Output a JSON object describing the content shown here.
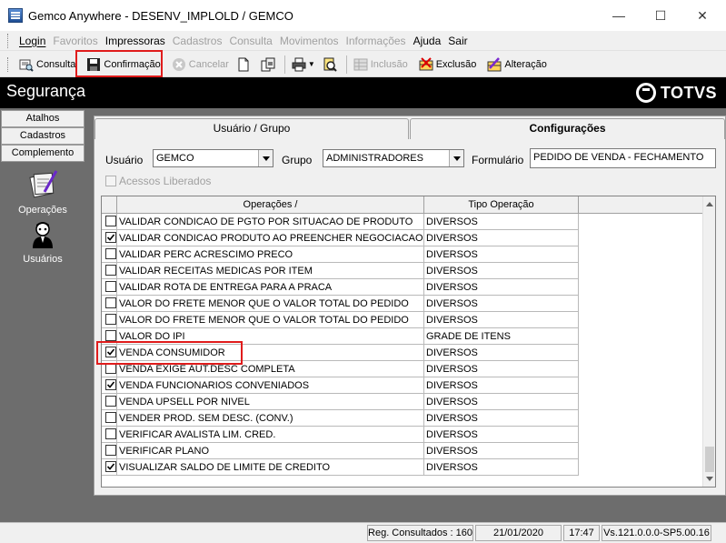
{
  "window": {
    "title": "Gemco Anywhere - DESENV_IMPLOLD / GEMCO",
    "minimize": "—",
    "maximize": "☐",
    "close": "✕"
  },
  "menu": [
    {
      "label": "Login",
      "enabled": true
    },
    {
      "label": "Favoritos",
      "enabled": false
    },
    {
      "label": "Impressoras",
      "enabled": true
    },
    {
      "label": "Cadastros",
      "enabled": false
    },
    {
      "label": "Consulta",
      "enabled": false
    },
    {
      "label": "Movimentos",
      "enabled": false
    },
    {
      "label": "Informações",
      "enabled": false
    },
    {
      "label": "Ajuda",
      "enabled": true
    },
    {
      "label": "Sair",
      "enabled": true
    }
  ],
  "toolbar": {
    "consulta": "Consulta",
    "confirmacao": "Confirmação",
    "cancelar": "Cancelar",
    "inclusao": "Inclusão",
    "exclusao": "Exclusão",
    "alteracao": "Alteração"
  },
  "header": {
    "title": "Segurança",
    "brand": "TOTVS"
  },
  "sidebar": {
    "atalhos": "Atalhos",
    "cadastros": "Cadastros",
    "complemento": "Complemento",
    "operacoes": "Operações",
    "usuarios": "Usuários"
  },
  "tabs": {
    "usuario_grupo": "Usuário  / Grupo",
    "configuracoes": "Configurações"
  },
  "filters": {
    "usuario_label": "Usuário",
    "usuario_value": "GEMCO",
    "grupo_label": "Grupo",
    "grupo_value": "ADMINISTRADORES",
    "formulario_label": "Formulário",
    "formulario_value": "PEDIDO DE VENDA - FECHAMENTO",
    "acessos_liberados": "Acessos Liberados"
  },
  "table": {
    "headers": {
      "operacoes": "Operações  /",
      "tipo": "Tipo Operação"
    },
    "rows": [
      {
        "checked": false,
        "operacao": "VALIDAR CONDICAO DE PGTO POR SITUACAO DE PRODUTO",
        "tipo": "DIVERSOS"
      },
      {
        "checked": true,
        "operacao": "VALIDAR CONDICAO PRODUTO AO PREENCHER NEGOCIACAO",
        "tipo": "DIVERSOS"
      },
      {
        "checked": false,
        "operacao": "VALIDAR PERC ACRESCIMO PRECO",
        "tipo": "DIVERSOS"
      },
      {
        "checked": false,
        "operacao": "VALIDAR RECEITAS MEDICAS POR ITEM",
        "tipo": "DIVERSOS"
      },
      {
        "checked": false,
        "operacao": "VALIDAR ROTA DE ENTREGA PARA A PRACA",
        "tipo": "DIVERSOS"
      },
      {
        "checked": false,
        "operacao": "VALOR DO FRETE MENOR QUE O VALOR TOTAL DO PEDIDO",
        "tipo": "DIVERSOS"
      },
      {
        "checked": false,
        "operacao": "VALOR DO FRETE MENOR QUE O VALOR TOTAL DO PEDIDO",
        "tipo": "DIVERSOS"
      },
      {
        "checked": false,
        "operacao": "VALOR DO IPI",
        "tipo": "GRADE DE ITENS"
      },
      {
        "checked": true,
        "operacao": "VENDA CONSUMIDOR",
        "tipo": "DIVERSOS"
      },
      {
        "checked": false,
        "operacao": "VENDA EXIGE AUT.DESC COMPLETA",
        "tipo": "DIVERSOS"
      },
      {
        "checked": true,
        "operacao": "VENDA FUNCIONARIOS CONVENIADOS",
        "tipo": "DIVERSOS"
      },
      {
        "checked": false,
        "operacao": "VENDA UPSELL POR NIVEL",
        "tipo": "DIVERSOS"
      },
      {
        "checked": false,
        "operacao": "VENDER PROD. SEM DESC. (CONV.)",
        "tipo": "DIVERSOS"
      },
      {
        "checked": false,
        "operacao": "VERIFICAR AVALISTA LIM. CRED.",
        "tipo": "DIVERSOS"
      },
      {
        "checked": false,
        "operacao": "VERIFICAR PLANO",
        "tipo": "DIVERSOS"
      },
      {
        "checked": true,
        "operacao": "VISUALIZAR SALDO DE LIMITE DE CREDITO",
        "tipo": "DIVERSOS"
      }
    ]
  },
  "status": {
    "registros": "Reg. Consultados : 160",
    "data": "21/01/2020",
    "hora": "17:47",
    "versao": "Vs.121.0.0.0-SP5.00.16"
  },
  "colors": {
    "highlight": "#e01c1c",
    "header_bg": "#000000",
    "side_bg": "#6d6d6d"
  }
}
